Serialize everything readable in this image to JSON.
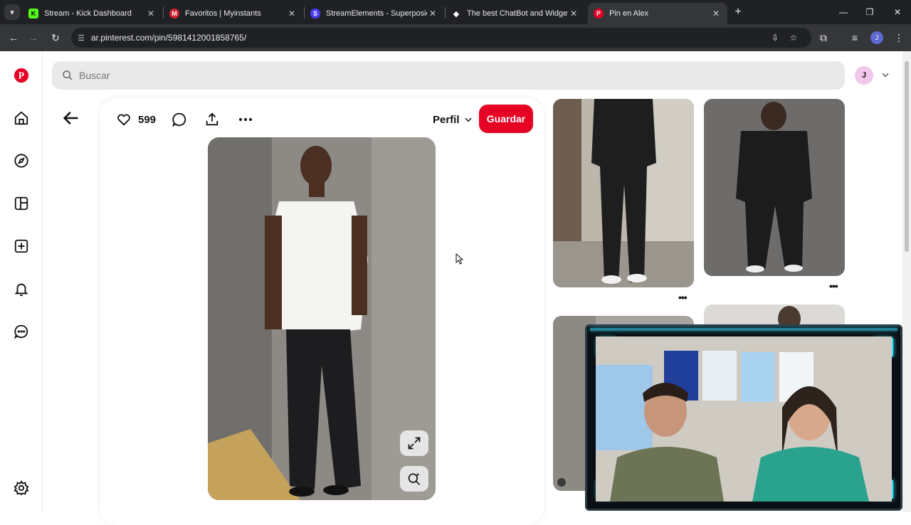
{
  "browser": {
    "tabs": [
      {
        "title": "Stream - Kick Dashboard",
        "favicon_color": "#53fc18",
        "favicon_glyph": "K"
      },
      {
        "title": "Favoritos | Myinstants",
        "favicon_color": "#d3202b",
        "favicon_glyph": "M"
      },
      {
        "title": "StreamElements - Superposicio",
        "favicon_color": "#4a3cff",
        "favicon_glyph": "S"
      },
      {
        "title": "The best ChatBot and Widgets",
        "favicon_color": "#ffffff",
        "favicon_glyph": "◆"
      },
      {
        "title": "Pin en Alex",
        "favicon_color": "#e60023",
        "favicon_glyph": "P"
      }
    ],
    "active_tab_index": 4,
    "url": "ar.pinterest.com/pin/5981412001858765/",
    "profile_initial": "J"
  },
  "pinterest": {
    "search_placeholder": "Buscar",
    "account_initial": "J",
    "like_count": "599",
    "profile_label": "Perfil",
    "save_label": "Guardar",
    "nav_items": [
      "pinterest-logo-icon",
      "home-icon",
      "explore-icon",
      "boards-icon",
      "create-icon",
      "notifications-icon",
      "messages-icon",
      "settings-icon"
    ],
    "brand_color": "#e60023"
  }
}
